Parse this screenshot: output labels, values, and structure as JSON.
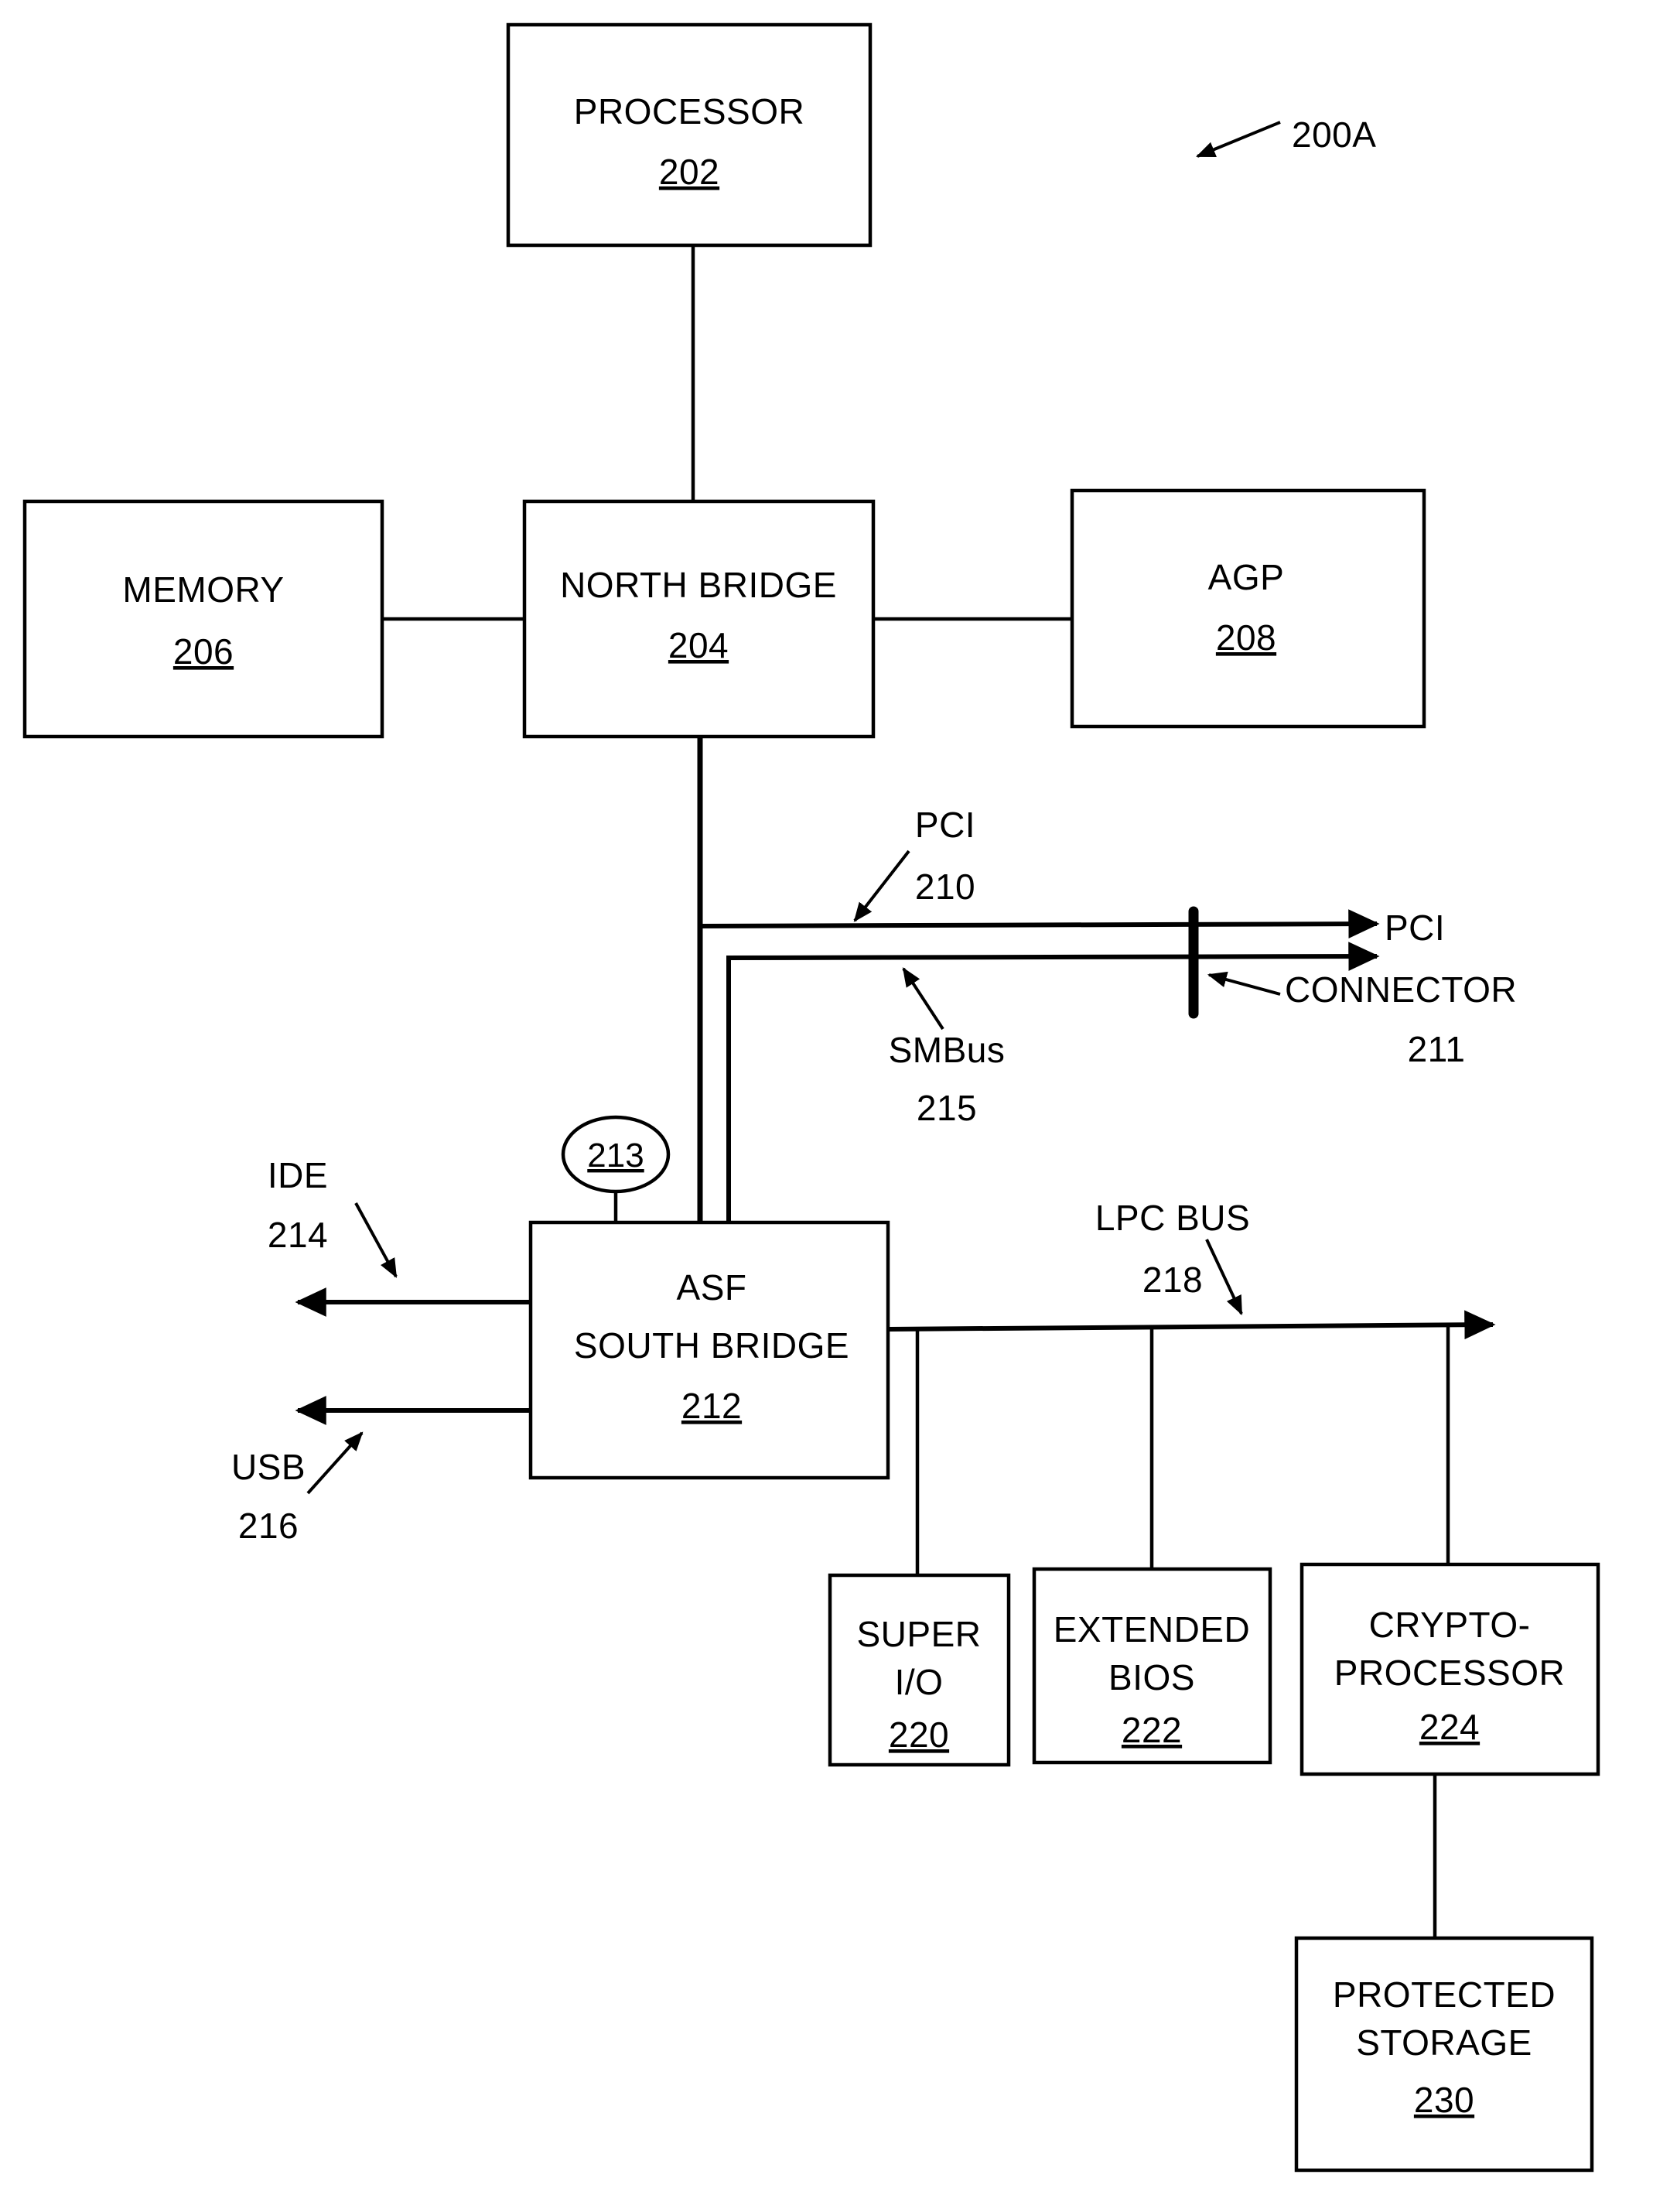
{
  "figure": {
    "figure_ref": "200A",
    "boxes": [
      {
        "id": "processor",
        "title": "PROCESSOR",
        "number": "202"
      },
      {
        "id": "memory",
        "title": "MEMORY",
        "number": "206"
      },
      {
        "id": "north_bridge",
        "title": "NORTH BRIDGE",
        "number": "204"
      },
      {
        "id": "agp",
        "title": "AGP",
        "number": "208"
      },
      {
        "id": "asf_south_bridge",
        "title": "ASF|SOUTH BRIDGE",
        "number": "212"
      },
      {
        "id": "super_io",
        "title": "SUPER|I/O",
        "number": "220"
      },
      {
        "id": "extended_bios",
        "title": "EXTENDED|BIOS",
        "number": "222"
      },
      {
        "id": "crypto_processor",
        "title": "CRYPTO-|PROCESSOR",
        "number": "224"
      },
      {
        "id": "protected_storage",
        "title": "PROTECTED|STORAGE",
        "number": "230"
      }
    ],
    "box_titles": {
      "processor": "PROCESSOR",
      "memory": "MEMORY",
      "north_bridge": "NORTH BRIDGE",
      "agp": "AGP",
      "asf_south_bridge_line1": "ASF",
      "asf_south_bridge_line2": "SOUTH BRIDGE",
      "super_io_line1": "SUPER",
      "super_io_line2": "I/O",
      "extended_bios_line1": "EXTENDED",
      "extended_bios_line2": "BIOS",
      "crypto_processor_line1": "CRYPTO-",
      "crypto_processor_line2": "PROCESSOR",
      "protected_storage_line1": "PROTECTED",
      "protected_storage_line2": "STORAGE"
    },
    "box_numbers": {
      "processor": "202",
      "memory": "206",
      "north_bridge": "204",
      "agp": "208",
      "asf_south_bridge": "212",
      "super_io": "220",
      "extended_bios": "222",
      "crypto_processor": "224",
      "protected_storage": "230"
    },
    "callouts": {
      "pci_bus_label": "PCI",
      "pci_bus_number": "210",
      "smbus_label": "SMBus",
      "smbus_number": "215",
      "pci_connector_line1": "PCI",
      "pci_connector_line2": "CONNECTOR",
      "pci_connector_number": "211",
      "ide_label": "IDE",
      "ide_number": "214",
      "usb_label": "USB",
      "usb_number": "216",
      "lpc_bus_label": "LPC BUS",
      "lpc_bus_number": "218",
      "node_213": "213"
    },
    "colors": {
      "ink": "#000000",
      "paper": "#ffffff"
    }
  }
}
